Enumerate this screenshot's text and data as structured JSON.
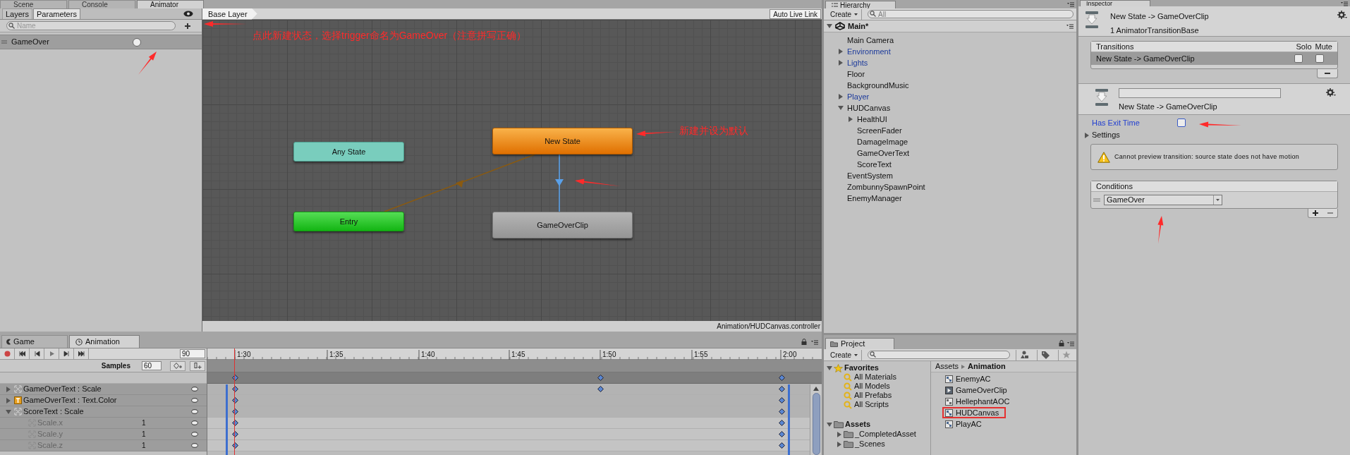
{
  "top_tabs": [
    {
      "label": "Scene",
      "selected": false
    },
    {
      "label": "Console",
      "selected": false
    },
    {
      "label": "Animator",
      "selected": true
    }
  ],
  "parameters_panel": {
    "tabs": [
      {
        "label": "Layers",
        "selected": false
      },
      {
        "label": "Parameters",
        "selected": true
      }
    ],
    "search": {
      "placeholder": "Name"
    },
    "parameters": [
      {
        "name": "GameOver",
        "triggered": false
      }
    ]
  },
  "animator": {
    "breadcrumb": "Base Layer",
    "live_link": "Auto Live Link",
    "states": [
      {
        "label": "New State",
        "kind": "default"
      },
      {
        "label": "Any State",
        "kind": "any"
      },
      {
        "label": "Entry",
        "kind": "entry"
      },
      {
        "label": "GameOverClip",
        "kind": "normal"
      }
    ],
    "path": "Animation/HUDCanvas.controller"
  },
  "annotations": [
    {
      "text": "点此新建状态，选择trigger命名为GameOver（注意拼写正确）"
    },
    {
      "text": "新建并设为默认"
    }
  ],
  "animation": {
    "tabs": [
      {
        "label": "Game",
        "selected": false
      },
      {
        "label": "Animation",
        "selected": true
      }
    ],
    "frame": "90",
    "samples_label": "Samples",
    "samples": "60",
    "ruler": [
      "1:30",
      "1:35",
      "1:40",
      "1:45",
      "1:50",
      "1:55",
      "2:00"
    ],
    "properties": [
      {
        "label": "GameOverText : Scale",
        "kind": "transform",
        "expanded": false
      },
      {
        "label": "GameOverText : Text.Color",
        "kind": "text",
        "expanded": false
      },
      {
        "label": "ScoreText : Scale",
        "kind": "transform",
        "expanded": true,
        "children": [
          {
            "label": "Scale.x",
            "value": "1"
          },
          {
            "label": "Scale.y",
            "value": "1"
          },
          {
            "label": "Scale.z",
            "value": "1"
          }
        ]
      }
    ]
  },
  "hierarchy": {
    "title": "Hierarchy",
    "create": "Create",
    "search": {
      "placeholder": "All"
    },
    "scene": "Main*",
    "items": [
      {
        "label": "Main Camera",
        "prefab": false
      },
      {
        "label": "Environment",
        "prefab": true,
        "expanded": false
      },
      {
        "label": "Lights",
        "prefab": true,
        "expanded": false
      },
      {
        "label": "Floor",
        "prefab": false
      },
      {
        "label": "BackgroundMusic",
        "prefab": false
      },
      {
        "label": "Player",
        "prefab": true,
        "expanded": false
      },
      {
        "label": "HUDCanvas",
        "prefab": false,
        "expanded": true,
        "children": [
          {
            "label": "HealthUI",
            "prefab": false,
            "expanded": false
          },
          {
            "label": "ScreenFader",
            "prefab": false
          },
          {
            "label": "DamageImage",
            "prefab": false
          },
          {
            "label": "GameOverText",
            "prefab": false
          },
          {
            "label": "ScoreText",
            "prefab": false
          }
        ]
      },
      {
        "label": "EventSystem",
        "prefab": false
      },
      {
        "label": "ZombunnySpawnPoint",
        "prefab": false
      },
      {
        "label": "EnemyManager",
        "prefab": false
      }
    ]
  },
  "project": {
    "title": "Project",
    "create": "Create",
    "favorites": {
      "label": "Favorites",
      "expanded": true,
      "items": [
        "All Materials",
        "All Models",
        "All Prefabs",
        "All Scripts"
      ]
    },
    "assets": {
      "label": "Assets",
      "expanded": true,
      "children": [
        {
          "label": "_CompletedAsset",
          "expanded": false
        },
        {
          "label": "_Scenes",
          "expanded": false
        }
      ]
    },
    "breadcrumb": [
      "Assets",
      "Animation"
    ],
    "files": [
      {
        "name": "EnemyAC",
        "kind": "controller",
        "highlighted": false
      },
      {
        "name": "GameOverClip",
        "kind": "clip",
        "highlighted": false
      },
      {
        "name": "HellephantAOC",
        "kind": "override",
        "highlighted": false
      },
      {
        "name": "HUDCanvas",
        "kind": "controller",
        "highlighted": true
      },
      {
        "name": "PlayAC",
        "kind": "controller",
        "highlighted": false
      }
    ]
  },
  "inspector": {
    "title": "Inspector",
    "heading": "New State -> GameOverClip",
    "subheading": "1 AnimatorTransitionBase",
    "transitions": {
      "header": "Transitions",
      "solo_label": "Solo",
      "mute_label": "Mute",
      "rows": [
        {
          "label": "New State -> GameOverClip",
          "selected": true,
          "solo": false,
          "mute": false
        }
      ]
    },
    "transition_label": "New State -> GameOverClip",
    "has_exit_time": {
      "label": "Has Exit Time",
      "checked": false
    },
    "settings": {
      "label": "Settings",
      "expanded": false
    },
    "warning": "Cannot preview transition: source state does not have motion",
    "conditions": {
      "header": "Conditions",
      "items": [
        {
          "parameter": "GameOver"
        }
      ]
    }
  }
}
